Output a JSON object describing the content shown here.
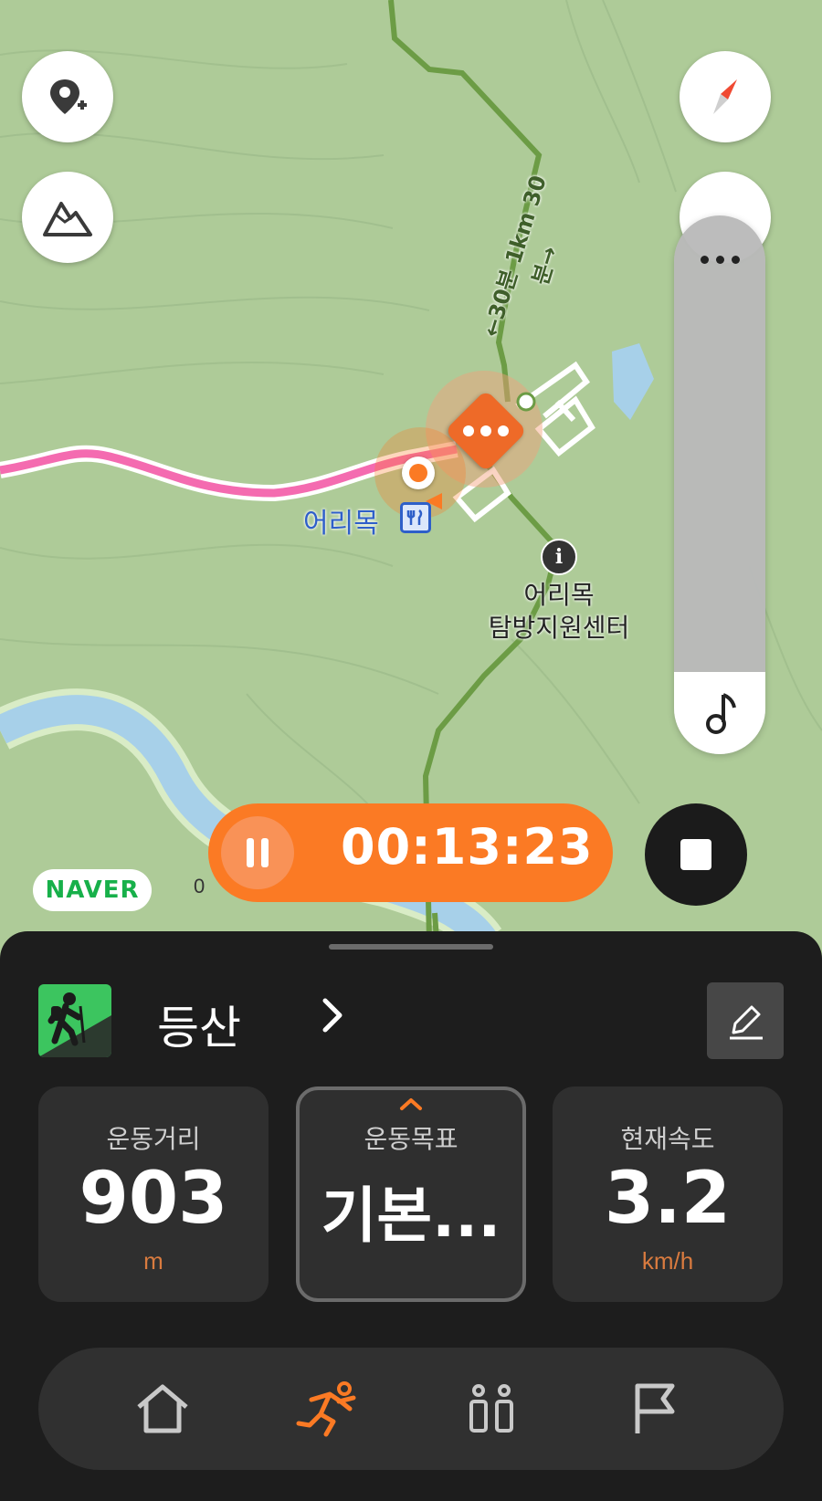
{
  "map": {
    "trail_label": "←30분 1km 30분→",
    "poi_label": "어리목",
    "info_label_line1": "어리목",
    "info_label_line2": "탐방지원센터",
    "brand": "NAVER",
    "scale_label": "0"
  },
  "map_controls": {
    "add_location_icon": "pin-plus-icon",
    "terrain_icon": "mountain-icon",
    "compass_icon": "compass-icon",
    "more_icon": "more-dots-icon",
    "music_icon": "music-note-icon"
  },
  "recording": {
    "elapsed": "00:13:23",
    "accent": "#fb7a24"
  },
  "activity": {
    "type_label": "등산",
    "icon": "hiker-icon",
    "icon_color": "#3cc55f"
  },
  "stats": [
    {
      "label": "운동거리",
      "value": "903",
      "unit": "m"
    },
    {
      "label": "운동목표",
      "value": "기본...",
      "unit": ""
    },
    {
      "label": "현재속도",
      "value": "3.2",
      "unit": "km/h"
    }
  ],
  "nav": {
    "items": [
      "home-icon",
      "running-icon",
      "people-icon",
      "flag-icon"
    ],
    "active_index": 1,
    "active_color": "#fb7a24"
  }
}
